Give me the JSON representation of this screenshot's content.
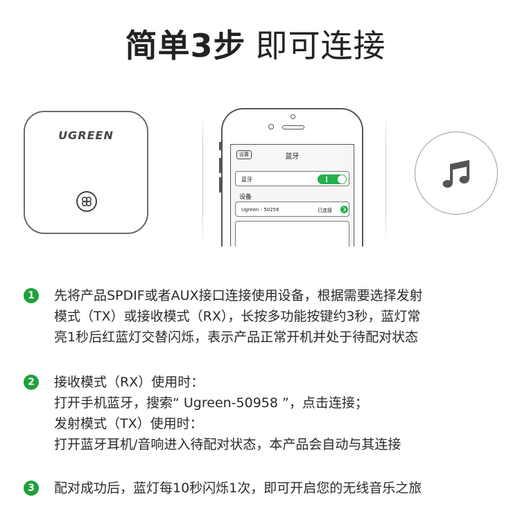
{
  "title": {
    "bold": "简单3步",
    "light": "即可连接"
  },
  "device": {
    "logo": "UGREEN"
  },
  "phone": {
    "back_label": "设置",
    "screen_title": "蓝牙",
    "bluetooth_label": "蓝牙",
    "devices_label": "设备",
    "device_name": "Ugreen - 50256",
    "device_status": "已连接"
  },
  "steps": [
    {
      "number": "1",
      "lines": [
        "先将产品SPDIF或者AUX接口连接使用设备，根据需要选择发射",
        "模式（TX）或接收模式（RX），长按多功能按键约3秒，蓝灯常",
        "亮1秒后红蓝灯交替闪烁，表示产品正常开机并处于待配对状态"
      ]
    },
    {
      "number": "2",
      "lines": [
        "接收模式（RX）使用时：",
        "打开手机蓝牙，搜索“ Ugreen-50958 ”，点击连接；",
        "发射模式（TX）使用时：",
        "打开蓝牙耳机/音响进入待配对状态，本产品会自动与其连接"
      ]
    },
    {
      "number": "3",
      "lines": [
        "配对成功后，蓝灯每10秒闪烁1次，即可开启您的无线音乐之旅"
      ]
    }
  ],
  "colors": {
    "accent_green": "#1fa13b",
    "toggle_green": "#22b14c"
  },
  "icons": [
    "clover-button-icon",
    "music-note-icon",
    "chevron-right-icon"
  ]
}
